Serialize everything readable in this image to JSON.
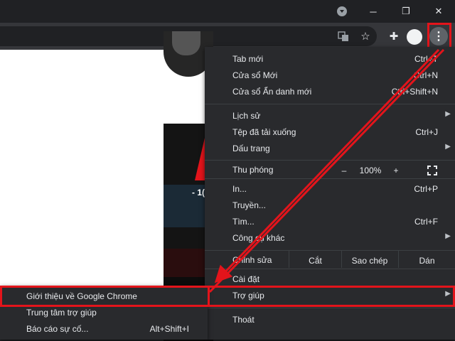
{
  "window": {
    "media_icon": "media-control-icon",
    "minimize_glyph": "─",
    "maximize_glyph": "❐",
    "close_glyph": "✕"
  },
  "toolbar": {
    "translate_icon": "translate-icon",
    "bookmark_glyph": "☆",
    "extensions_glyph": "✚",
    "menu_glyph": "⋮"
  },
  "menu": {
    "new_tab": {
      "label": "Tab mới",
      "shortcut": "Ctrl+T"
    },
    "new_window": {
      "label": "Cửa sổ Mới",
      "shortcut": "Ctrl+N"
    },
    "incognito": {
      "label": "Cửa sổ Ẩn danh mới",
      "shortcut": "Ctrl+Shift+N"
    },
    "history": {
      "label": "Lịch sử"
    },
    "downloads": {
      "label": "Tệp đã tải xuống",
      "shortcut": "Ctrl+J"
    },
    "bookmarks": {
      "label": "Dấu trang"
    },
    "zoom": {
      "label": "Thu phóng",
      "minus": "–",
      "value": "100%",
      "plus": "+"
    },
    "print": {
      "label": "In...",
      "shortcut": "Ctrl+P"
    },
    "cast": {
      "label": "Truyền..."
    },
    "find": {
      "label": "Tìm...",
      "shortcut": "Ctrl+F"
    },
    "more_tools": {
      "label": "Công cụ khác"
    },
    "edit": {
      "label": "Chỉnh sửa",
      "cut": "Cắt",
      "copy": "Sao chép",
      "paste": "Dán"
    },
    "settings": {
      "label": "Cài đặt"
    },
    "help": {
      "label": "Trợ giúp"
    },
    "exit": {
      "label": "Thoát"
    },
    "arrow_glyph": "▶"
  },
  "help_submenu": {
    "about": {
      "label": "Giới thiệu về Google Chrome"
    },
    "help_center": {
      "label": "Trung tâm trợ giúp"
    },
    "report": {
      "label": "Báo cáo sự cố...",
      "shortcut": "Alt+Shift+I"
    }
  },
  "page": {
    "image_text": "- 1("
  },
  "colors": {
    "highlight": "#e3141b",
    "menu_bg": "#292a2d",
    "toolbar_bg": "#35363a"
  }
}
